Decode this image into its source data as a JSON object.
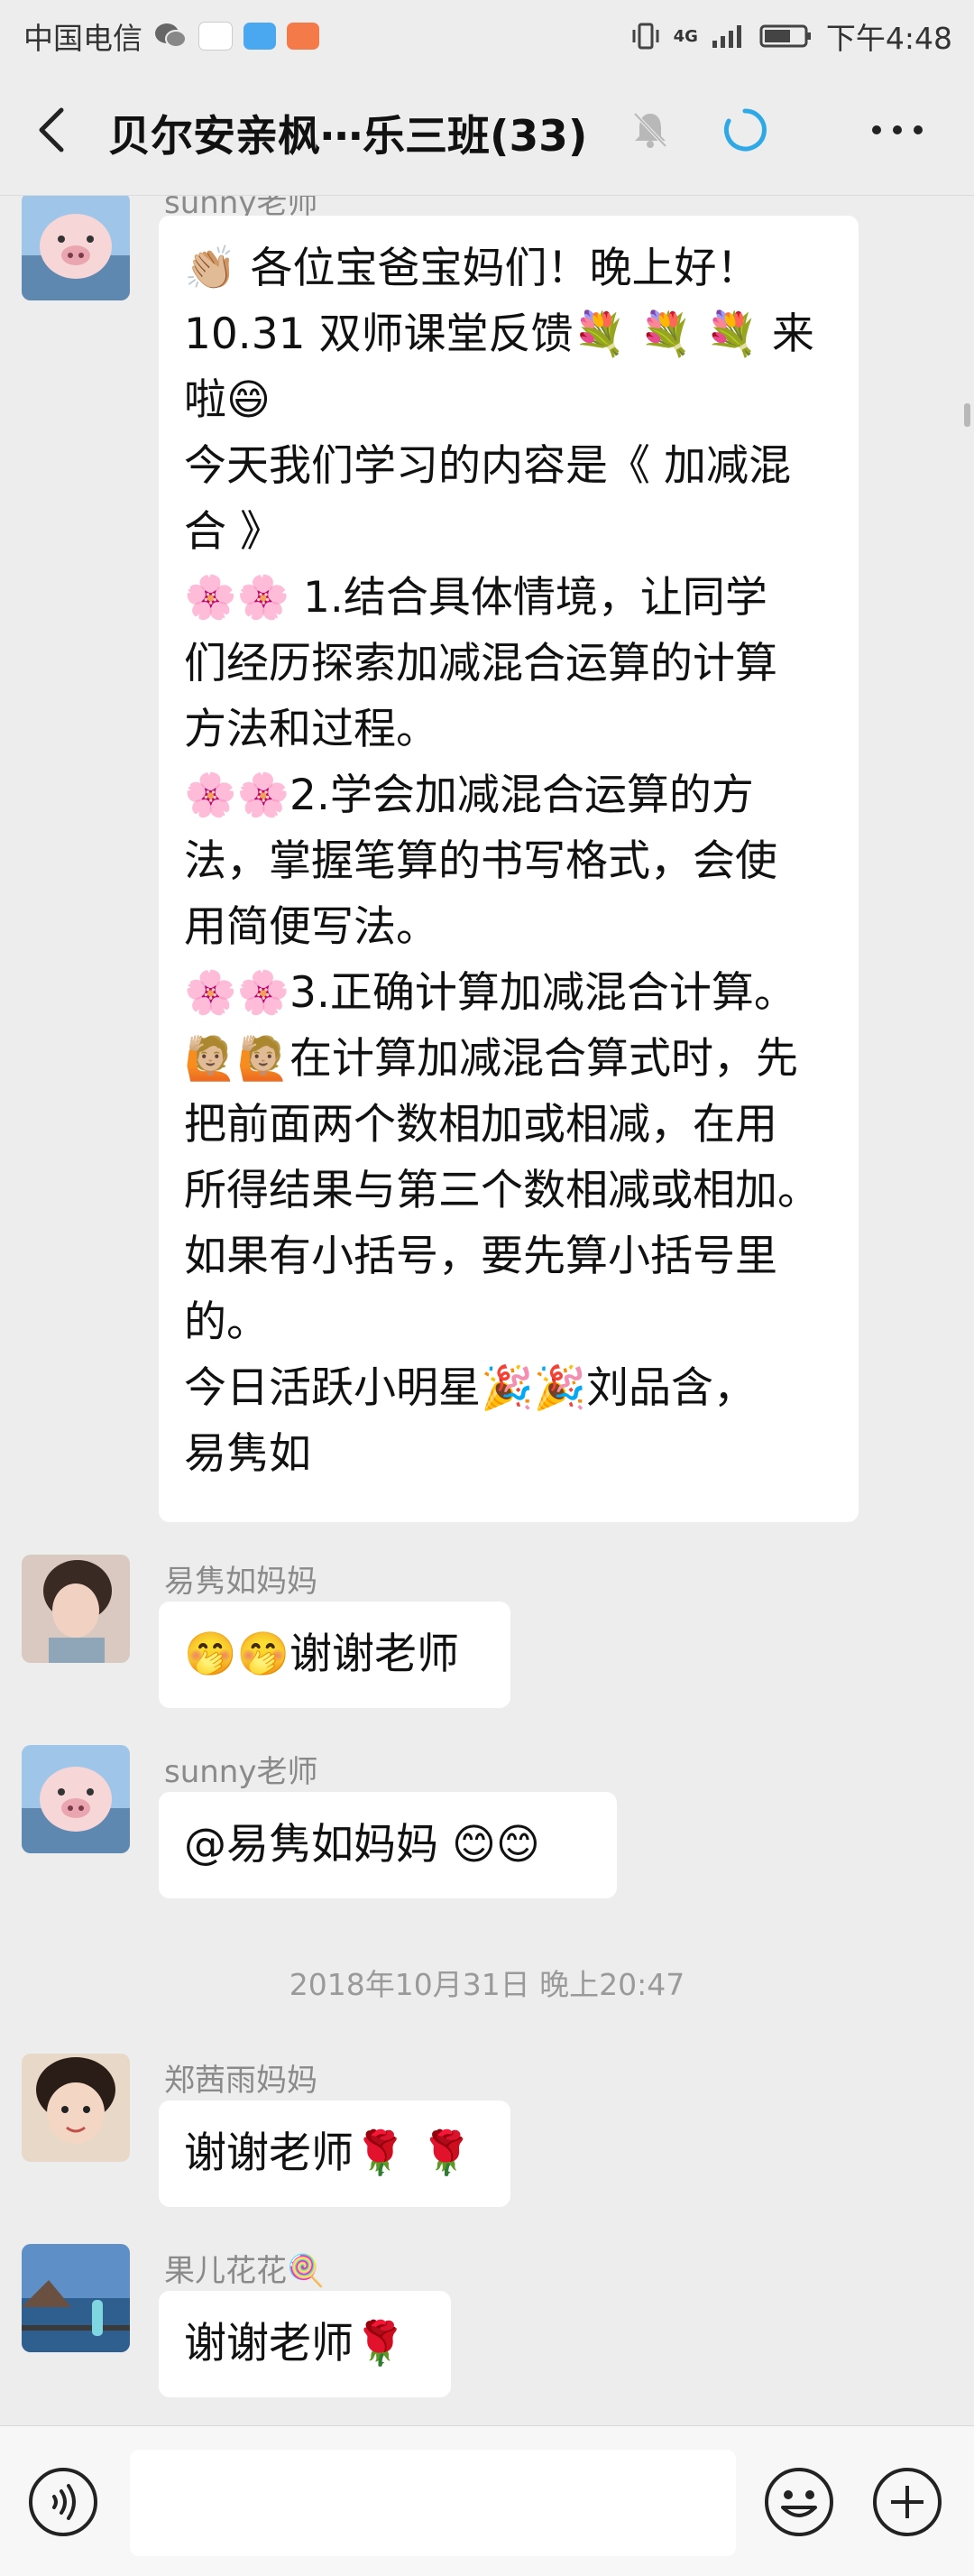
{
  "status_bar": {
    "carrier": "中国电信",
    "network": "4G",
    "time": "下午4:48"
  },
  "nav": {
    "title": "贝尔安亲枫⋯乐三班(33)"
  },
  "messages": [
    {
      "sender": "sunny老师",
      "lines": [
        "👏🏼 各位宝爸宝妈们！晚上好！",
        "10.31 双师课堂反馈💐 💐 💐 来",
        "啦😄",
        "今天我们学习的内容是《 加减混",
        "合 》",
        "🌸🌸 1.结合具体情境，让同学",
        "们经历探索加减混合运算的计算",
        "方法和过程。",
        "🌸🌸2.学会加减混合运算的方",
        "法，掌握笔算的书写格式，会使",
        "用简便写法。",
        "🌸🌸3.正确计算加减混合计算。",
        "🙋🏼🙋🏼在计算加减混合算式时，先",
        "把前面两个数相加或相减，在用",
        "所得结果与第三个数相减或相加。",
        "如果有小括号，要先算小括号里",
        "的。",
        "  今日活跃小明星🎉🎉刘品含，",
        "易隽如"
      ]
    },
    {
      "sender": "易隽如妈妈",
      "lines": [
        "🤭🤭谢谢老师"
      ]
    },
    {
      "sender": "sunny老师",
      "lines": [
        "@易隽如妈妈  😊😊"
      ]
    },
    {
      "sender": "郑茜雨妈妈",
      "lines": [
        "谢谢老师🌹 🌹"
      ]
    },
    {
      "sender": "果儿花花🍭",
      "lines": [
        "谢谢老师🌹"
      ]
    }
  ],
  "timestamp": "2018年10月31日 晚上20:47",
  "colors": {
    "background": "#ededed",
    "bubble": "#ffffff",
    "sync_icon": "#2fa8e6"
  }
}
